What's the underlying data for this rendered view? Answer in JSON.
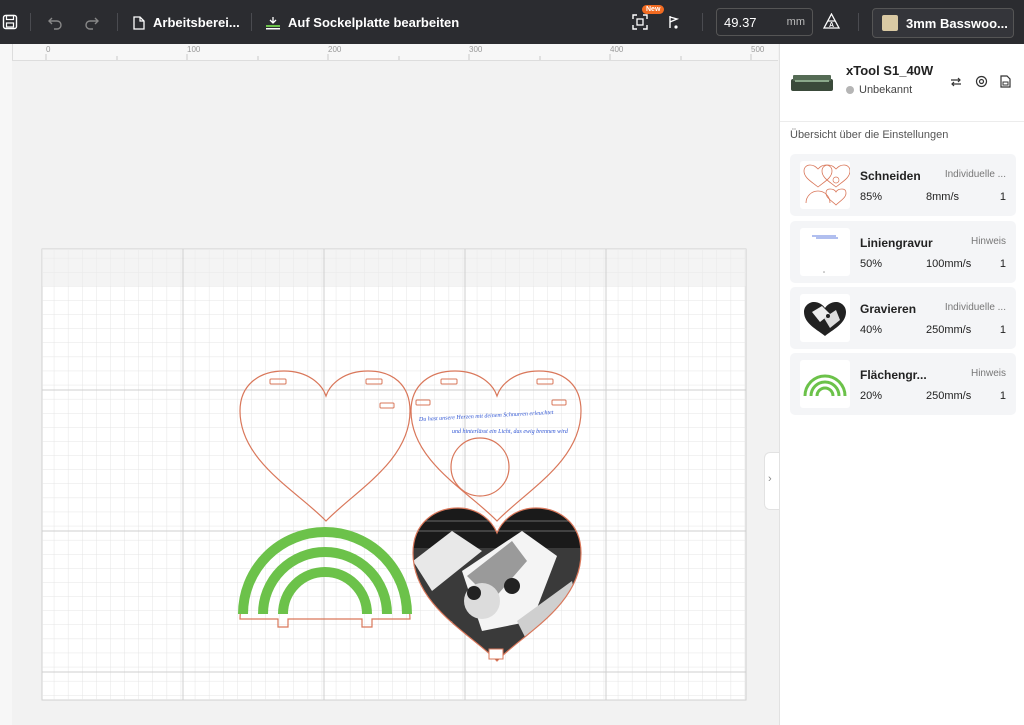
{
  "toolbar": {
    "workspace_label": "Arbeitsberei...",
    "base_plate_label": "Auf Sockelplatte bearbeiten",
    "new_badge": "New",
    "value": "49.37",
    "unit": "mm",
    "material": "3mm Basswoo..."
  },
  "ruler": {
    "ticks": [
      "0",
      "100",
      "200",
      "300",
      "400",
      "500"
    ]
  },
  "canvas": {
    "engraving_text_line1": "Du hast unsere Herzen mit deinem Schnurren erleuchtet",
    "engraving_text_line2": "und hinterlässt ein Licht, das ewig brennen wird"
  },
  "device": {
    "name": "xTool S1_40W",
    "status": "Unbekannt"
  },
  "panel": {
    "title": "Übersicht über die Einstellungen",
    "layers": [
      {
        "name": "Schneiden",
        "mode": "Individuelle ...",
        "power": "85%",
        "speed": "8mm/s",
        "passes": "1"
      },
      {
        "name": "Liniengravur",
        "mode": "Hinweis",
        "power": "50%",
        "speed": "100mm/s",
        "passes": "1"
      },
      {
        "name": "Gravieren",
        "mode": "Individuelle ...",
        "power": "40%",
        "speed": "250mm/s",
        "passes": "1"
      },
      {
        "name": "Flächengr...",
        "mode": "Hinweis",
        "power": "20%",
        "speed": "250mm/s",
        "passes": "1"
      }
    ]
  },
  "colors": {
    "toolbar_bg": "#2b2c30",
    "cut_line": "#d9775a",
    "fill_green": "#6cc24a",
    "text_blue": "#2f55d4",
    "badge": "#f26b21"
  }
}
